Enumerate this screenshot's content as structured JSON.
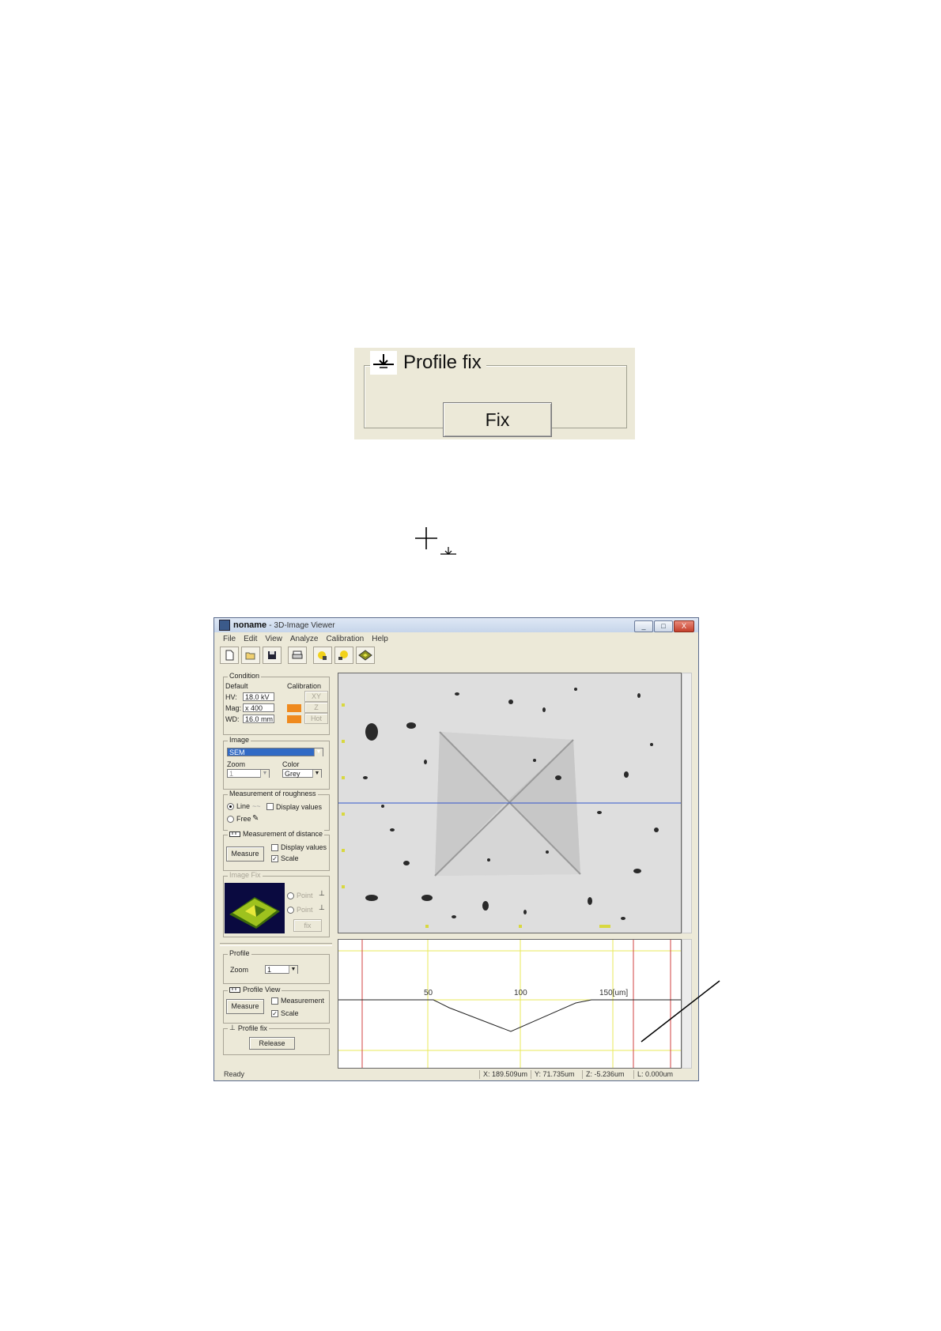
{
  "profile_fix_panel": {
    "title": "Profile fix",
    "fix_button": "Fix"
  },
  "window": {
    "title_name": "noname",
    "title_sep": "-",
    "title_app": "3D-Image Viewer",
    "controls": [
      "_",
      "□",
      "X"
    ],
    "menu": [
      "File",
      "Edit",
      "View",
      "Analyze",
      "Calibration",
      "Help"
    ],
    "toolbar": [
      "new-icon",
      "open-icon",
      "save-icon",
      "print-icon",
      "image-fix-icon",
      "image-fix2-icon",
      "3d-view-icon"
    ]
  },
  "condition": {
    "title": "Condition",
    "default_label": "Default",
    "calibration_label": "Calibration",
    "hv_label": "HV:",
    "hv_value": "18.0 kV",
    "mag_label": "Mag:",
    "mag_value": "x 400",
    "wd_label": "WD:",
    "wd_value": "16.0 mm",
    "cal_xy": "XY",
    "cal_z": "Z",
    "cal_hot": "Hot"
  },
  "image_group": {
    "title": "Image",
    "selected": "SEM",
    "zoom_label": "Zoom",
    "zoom_value": "1",
    "color_label": "Color",
    "color_value": "Grey"
  },
  "roughness": {
    "title": "Measurement of roughness",
    "line_label": "Line",
    "display_values_label": "Display values",
    "free_label": "Free"
  },
  "distance": {
    "title": "Measurement of distance",
    "measure_button": "Measure",
    "display_values_label": "Display values",
    "scale_label": "Scale"
  },
  "image_fix": {
    "title": "Image Fix",
    "point1_label": "Point",
    "point2_label": "Point",
    "fix_button": "fix"
  },
  "profile_group": {
    "title": "Profile",
    "zoom_label": "Zoom",
    "zoom_value": "1"
  },
  "profile_view_group": {
    "title": "Profile View",
    "measure_button": "Measure",
    "measurement_label": "Measurement",
    "scale_label": "Scale"
  },
  "profile_fix_group": {
    "title": "Profile fix",
    "release_button": "Release"
  },
  "profile_chart": {
    "tick_labels": [
      "50",
      "100",
      "150[um]"
    ]
  },
  "status": {
    "ready": "Ready",
    "x": "X: 189.509um",
    "y": "Y: 71.735um",
    "z": "Z: -5.236um",
    "l": "L: 0.000um"
  },
  "colors": {
    "orange_calibration": "#ef8a1e",
    "profile_grid": "#e8e85a",
    "profile_red": "#d04040",
    "image_cursor_line": "#3355cc"
  }
}
